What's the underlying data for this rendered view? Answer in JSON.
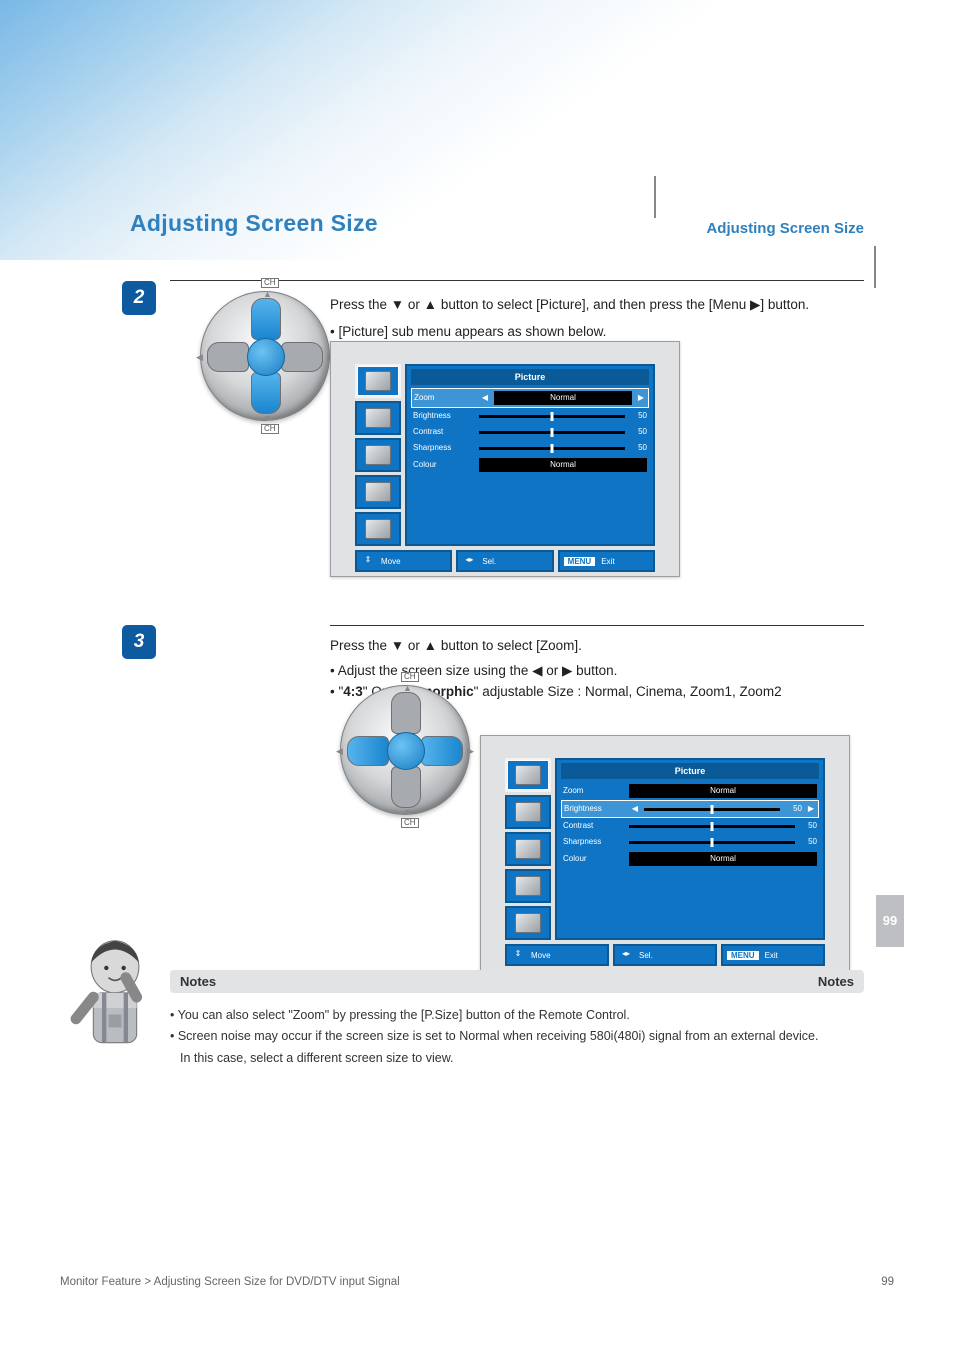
{
  "page": {
    "title": "Adjusting Screen Size",
    "subtitle": "Adjusting Screen Size",
    "footer_text": "Monitor Feature > Adjusting Screen Size for DVD/DTV input Signal",
    "page_number_tag": "99",
    "page_number_bottom": "99"
  },
  "step2": {
    "num": "2",
    "text_before_icons": "Press the ",
    "text_after_icons": " button to select [Picture], and then press the [Menu ▶] button.",
    "sublabel": "• [Picture] sub menu appears as shown below.",
    "dpad_top": "CH",
    "dpad_bottom": "CH",
    "osd": {
      "title": "Picture",
      "rows": [
        {
          "label": "Zoom",
          "value": "Normal",
          "type": "select",
          "selected": true
        },
        {
          "label": "Brightness",
          "value": "50",
          "type": "slider"
        },
        {
          "label": "Contrast",
          "value": "50",
          "type": "slider"
        },
        {
          "label": "Sharpness",
          "value": "50",
          "type": "slider"
        },
        {
          "label": "Colour",
          "value": "Normal",
          "type": "val"
        }
      ],
      "footer": {
        "move": "Move",
        "sel": "Sel.",
        "menu": "MENU",
        "exit": "Exit"
      }
    }
  },
  "step3": {
    "num": "3",
    "text_before_icons": "Press the ",
    "text_after_icons": " button to select [Zoom].",
    "sub1": "• Adjust the screen size using the ◀ or ▶ button.",
    "sub2_a": "• \"",
    "sub2_b": "\" Or \"",
    "sub2_c": "\" adjustable Size : Normal, Cinema, Zoom1, Zoom2",
    "sub_label_4by3": "4:3",
    "sub_label_anamorphic": "Anamorphic",
    "dpad_top": "CH",
    "dpad_bottom": "CH",
    "osd": {
      "title": "Picture",
      "rows": [
        {
          "label": "Zoom",
          "value": "Normal",
          "type": "val"
        },
        {
          "label": "Brightness",
          "value": "50",
          "type": "select",
          "selected": true,
          "slider": true
        },
        {
          "label": "Contrast",
          "value": "50",
          "type": "slider"
        },
        {
          "label": "Sharpness",
          "value": "50",
          "type": "slider"
        },
        {
          "label": "Colour",
          "value": "Normal",
          "type": "val"
        }
      ],
      "footer": {
        "move": "Move",
        "sel": "Sel.",
        "menu": "MENU",
        "exit": "Exit"
      }
    }
  },
  "notes": {
    "left": "Notes",
    "right": "Notes",
    "n1": "• You can also select \"Zoom\" by pressing the [P.Size] button of the Remote Control.",
    "n2": "• Screen noise may occur if the screen size is set to Normal when receiving 580i(480i) signal from an external device.",
    "n3": "In this case, select a different screen size to view."
  }
}
